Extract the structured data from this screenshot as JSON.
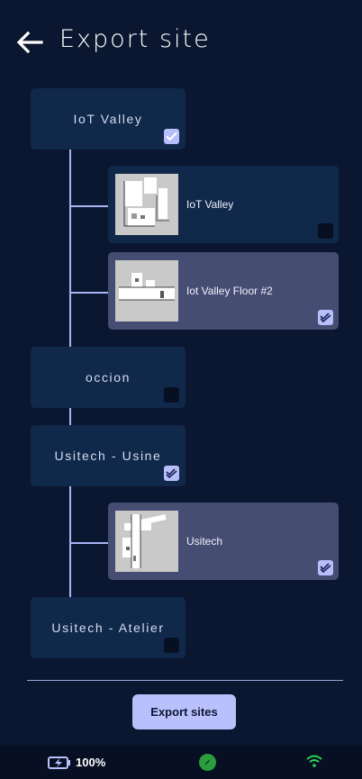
{
  "header": {
    "title": "Export site",
    "back_icon": "arrow-left-icon"
  },
  "sites": [
    {
      "label": "IoT Valley",
      "checked": true
    },
    {
      "label": "occion",
      "checked": false
    },
    {
      "label": "Usitech - Usine",
      "checked": true
    },
    {
      "label": "Usitech - Atelier",
      "checked": false
    }
  ],
  "floors": [
    {
      "label": "IoT Valley",
      "checked": false,
      "site": "IoT Valley"
    },
    {
      "label": "Iot Valley Floor #2",
      "checked": true,
      "site": "IoT Valley"
    },
    {
      "label": "Usitech",
      "checked": true,
      "site": "Usitech - Usine"
    }
  ],
  "footer": {
    "export_label": "Export sites"
  },
  "status_bar": {
    "battery_text": "100%",
    "battery_icon": "battery-charging-icon",
    "compass_icon": "compass-icon",
    "wifi_icon": "wifi-icon"
  },
  "colors": {
    "background": "#0b1730",
    "card": "#10284a",
    "card_selected": "#454d72",
    "accent": "#b9c0fb",
    "status_ok": "#2a9e3c"
  }
}
